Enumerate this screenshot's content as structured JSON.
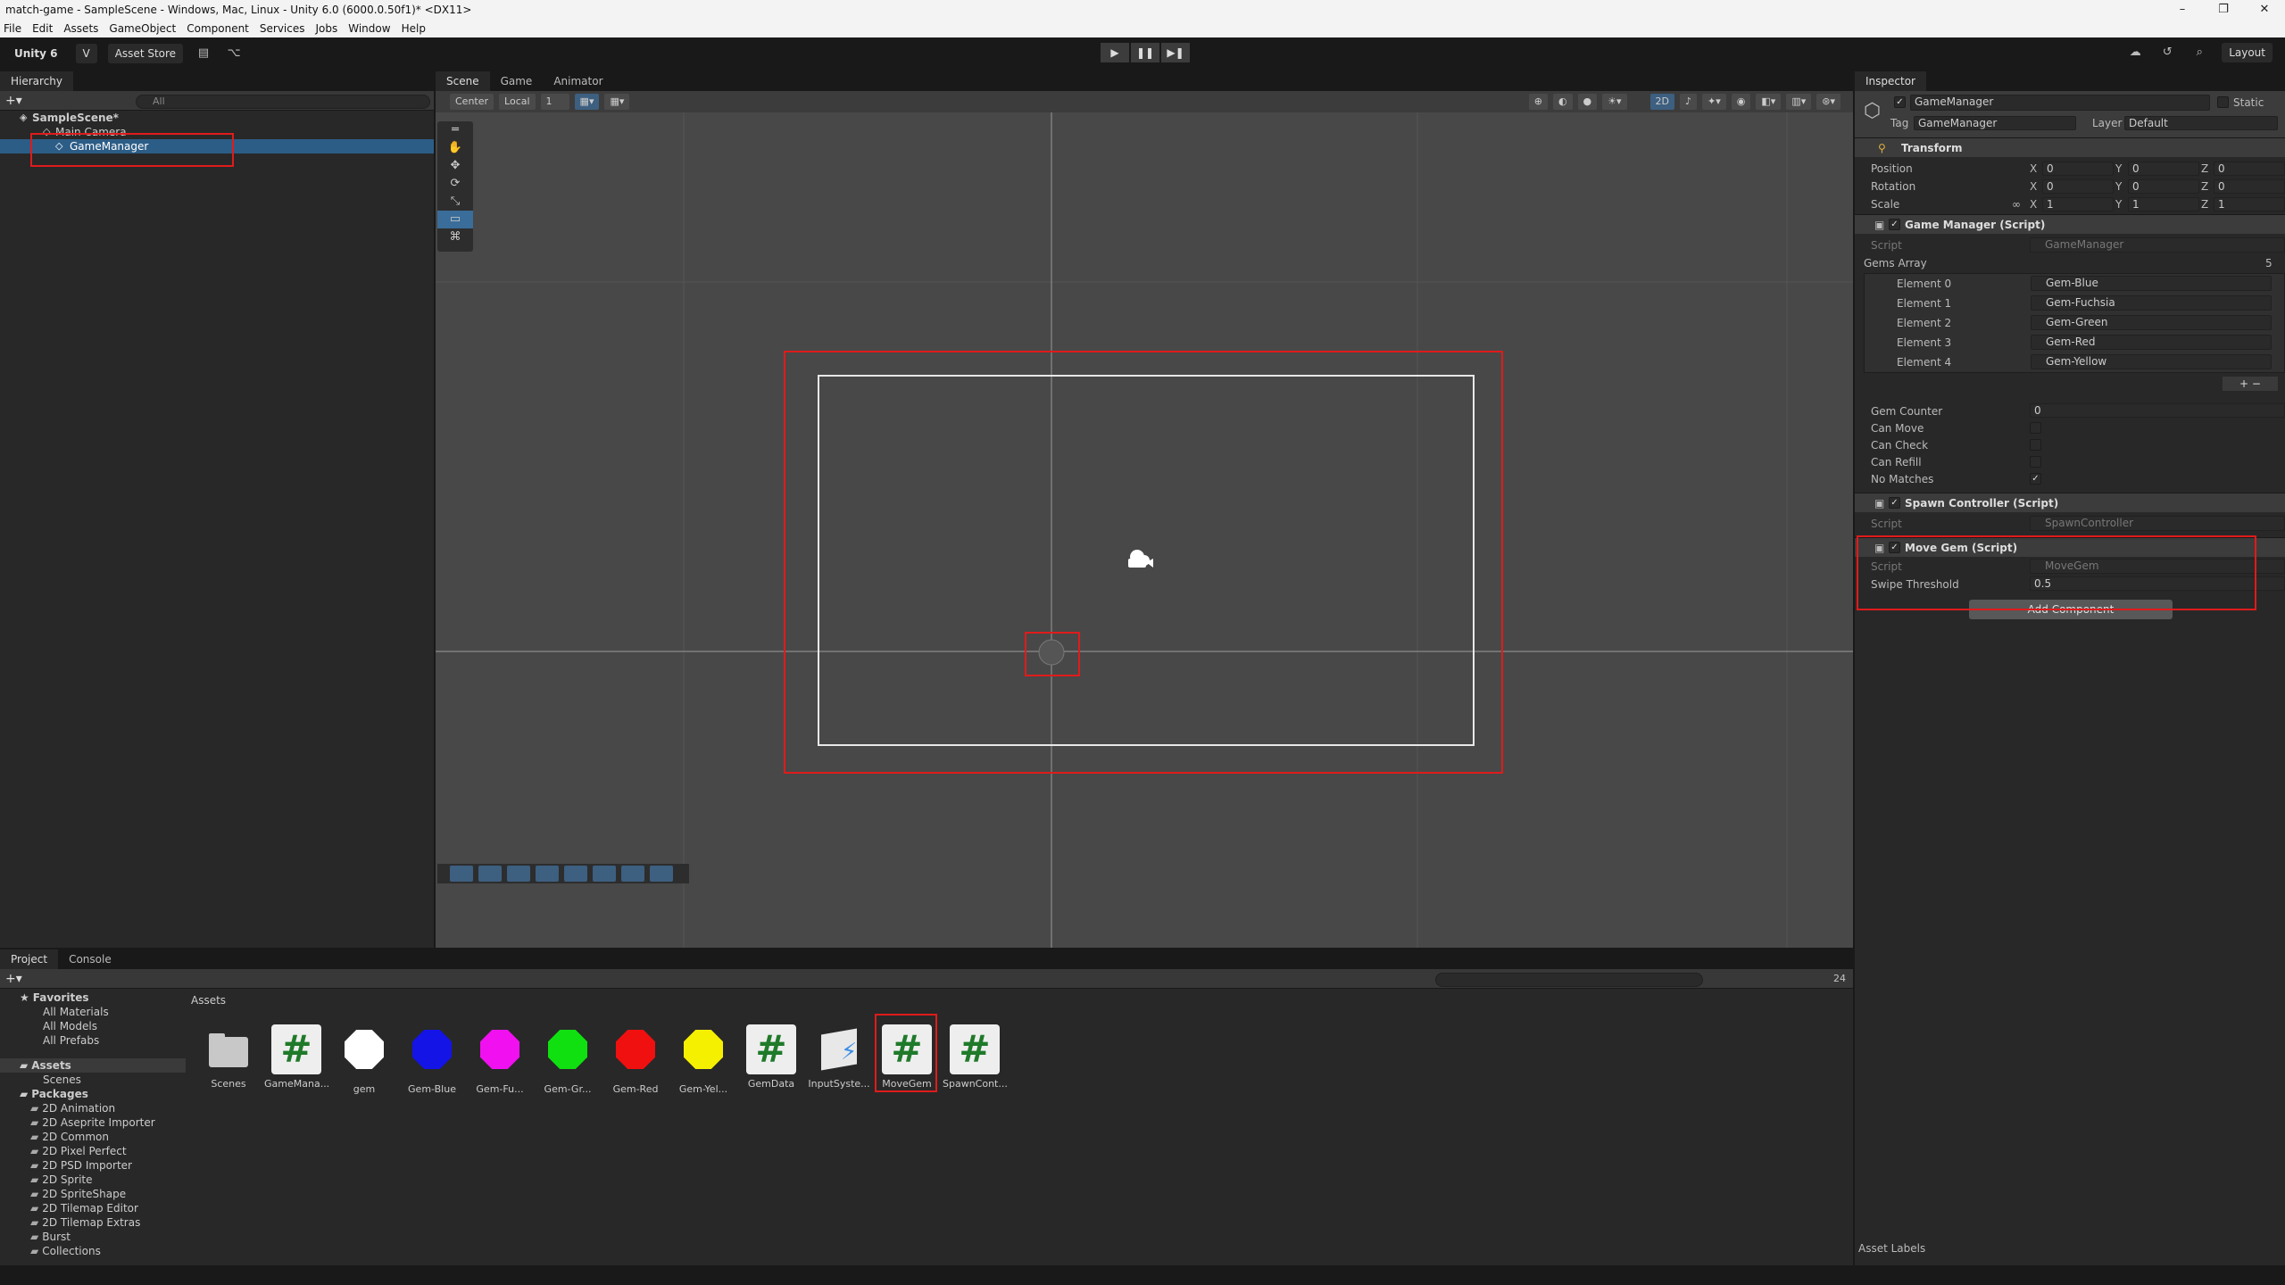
{
  "window": {
    "title": "match-game - SampleScene - Windows, Mac, Linux - Unity 6.0 (6000.0.50f1)* <DX11>",
    "controls": [
      "–",
      "❐",
      "✕"
    ]
  },
  "menu": [
    "File",
    "Edit",
    "Assets",
    "GameObject",
    "Component",
    "Services",
    "Jobs",
    "Window",
    "Help"
  ],
  "toolbar": {
    "unity_label": "Unity 6",
    "account_label": "V",
    "asset_store_label": "Asset Store",
    "layout_label": "Layout"
  },
  "hierarchy": {
    "tab": "Hierarchy",
    "search_placeholder": "All",
    "scene_name": "SampleScene*",
    "items": [
      "Main Camera",
      "GameManager"
    ],
    "selected": "GameManager"
  },
  "scene_view": {
    "tabs": [
      "Scene",
      "Game",
      "Animator"
    ],
    "pivot_label": "Center",
    "space_label": "Local",
    "grid_value": "1",
    "mode_2d_label": "2D"
  },
  "inspector": {
    "tab": "Inspector",
    "object_name": "GameManager",
    "static_label": "Static",
    "tag_label": "Tag",
    "tag_value": "GameManager",
    "layer_label": "Layer",
    "layer_value": "Default",
    "transform": {
      "title": "Transform",
      "rows": [
        {
          "label": "Position",
          "x": "0",
          "y": "0",
          "z": "0"
        },
        {
          "label": "Rotation",
          "x": "0",
          "y": "0",
          "z": "0"
        },
        {
          "label": "Scale",
          "x": "1",
          "y": "1",
          "z": "1"
        }
      ]
    },
    "game_manager": {
      "title": "Game Manager (Script)",
      "script_label": "Script",
      "script_value": "GameManager",
      "array_label": "Gems Array",
      "array_size": "5",
      "elements": [
        {
          "label": "Element 0",
          "value": "Gem-Blue"
        },
        {
          "label": "Element 1",
          "value": "Gem-Fuchsia"
        },
        {
          "label": "Element 2",
          "value": "Gem-Green"
        },
        {
          "label": "Element 3",
          "value": "Gem-Red"
        },
        {
          "label": "Element 4",
          "value": "Gem-Yellow"
        }
      ],
      "fields": [
        {
          "label": "Gem Counter",
          "value": "0"
        }
      ],
      "checks": [
        {
          "label": "Can Move",
          "checked": false
        },
        {
          "label": "Can Check",
          "checked": false
        },
        {
          "label": "Can Refill",
          "checked": false
        },
        {
          "label": "No Matches",
          "checked": true
        }
      ]
    },
    "spawn_controller": {
      "title": "Spawn Controller (Script)",
      "script_label": "Script",
      "script_value": "SpawnController"
    },
    "move_gem": {
      "title": "Move Gem (Script)",
      "script_label": "Script",
      "script_value": "MoveGem",
      "threshold_label": "Swipe Threshold",
      "threshold_value": "0.5"
    },
    "add_component": "Add Component",
    "asset_labels": "Asset Labels"
  },
  "project": {
    "tabs": [
      "Project",
      "Console"
    ],
    "breadcrumb": "Assets",
    "count": "24",
    "favorites_label": "Favorites",
    "favorites": [
      "All Materials",
      "All Models",
      "All Prefabs"
    ],
    "assets_label": "Assets",
    "asset_folders": [
      "Scenes"
    ],
    "packages_label": "Packages",
    "packages": [
      "2D Animation",
      "2D Aseprite Importer",
      "2D Common",
      "2D Pixel Perfect",
      "2D PSD Importer",
      "2D Sprite",
      "2D SpriteShape",
      "2D Tilemap Editor",
      "2D Tilemap Extras",
      "Burst",
      "Collections"
    ],
    "assets": [
      {
        "name": "Scenes",
        "kind": "folder"
      },
      {
        "name": "GameMana...",
        "kind": "script"
      },
      {
        "name": "gem",
        "kind": "sprite",
        "color": "#ffffff"
      },
      {
        "name": "Gem-Blue",
        "kind": "prefab",
        "color": "#1414e6"
      },
      {
        "name": "Gem-Fu...",
        "kind": "prefab",
        "color": "#f010f0"
      },
      {
        "name": "Gem-Gr...",
        "kind": "prefab",
        "color": "#10e010"
      },
      {
        "name": "Gem-Red",
        "kind": "prefab",
        "color": "#f01010"
      },
      {
        "name": "Gem-Yel...",
        "kind": "prefab",
        "color": "#f5f000"
      },
      {
        "name": "GemData",
        "kind": "script"
      },
      {
        "name": "InputSyste...",
        "kind": "input"
      },
      {
        "name": "MoveGem",
        "kind": "script"
      },
      {
        "name": "SpawnCont...",
        "kind": "script"
      }
    ]
  }
}
